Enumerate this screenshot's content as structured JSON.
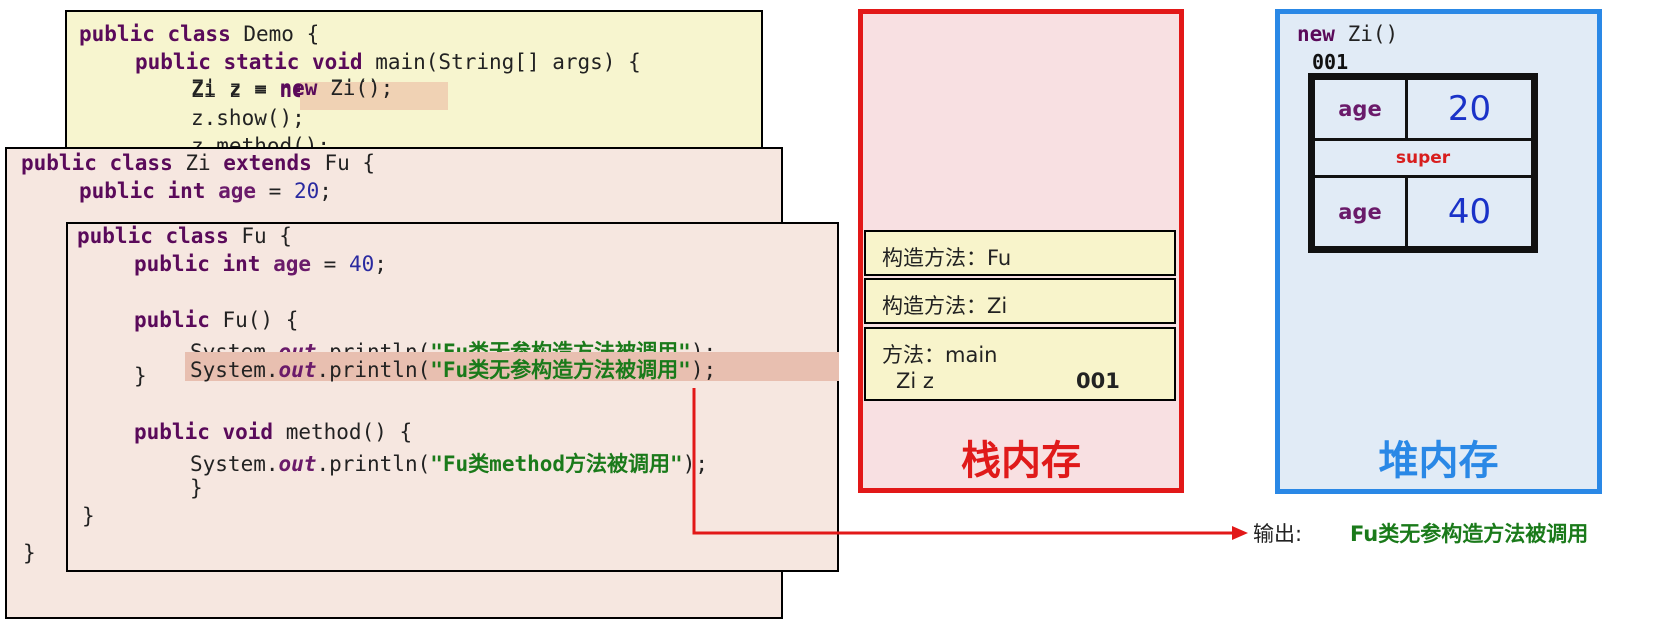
{
  "demo": {
    "l1_kw": "public class",
    "l1_txt": " Demo {",
    "l2_kw": "public static void",
    "l2_txt": " main(String[] args) {",
    "l3_pre": "Zi z = ",
    "l3_kw": "new",
    "l3_post": " Zi();",
    "l4": "z.show();",
    "l5": "z.method();"
  },
  "zi": {
    "l1_kw1": "public class",
    "l1_txt1": " Zi ",
    "l1_kw2": "extends",
    "l1_txt2": " Fu {",
    "l2_kw": "public int",
    "l2_id": "age",
    "l2_eq": " = ",
    "l2_num": "20",
    "l2_end": ";",
    "close": "}"
  },
  "fu": {
    "l1_kw": "public class",
    "l1_txt": " Fu {",
    "l2_kw": "public int",
    "l2_id": "age",
    "l2_eq": " = ",
    "l2_num": "40",
    "l2_end": ";",
    "ctor_kw": "public",
    "ctor_txt": " Fu() {",
    "p1_pre": "System.",
    "p1_out": "out",
    "p1_mid": ".println(",
    "p1_str": "\"Fu类无参构造方法被调用\"",
    "p1_end": ");",
    "close1": "}",
    "m_kw": "public void",
    "m_txt": " method() {",
    "p2_pre": "System.",
    "p2_out": "out",
    "p2_mid": ".println(",
    "p2_str": "\"Fu类method方法被调用\"",
    "p2_end": ");",
    "close2": "}",
    "close3": "}"
  },
  "stack": {
    "label": "栈内存",
    "frame_fu": "构造方法：Fu",
    "frame_zi": "构造方法：Zi",
    "frame_main": "方法：main",
    "var_name": "Zi z",
    "var_value": "001"
  },
  "heap": {
    "label": "堆内存",
    "title_kw": "new",
    "title_txt": " Zi()",
    "address": "001",
    "field1_name": "age",
    "field1_value": "20",
    "super_label": "super",
    "field2_name": "age",
    "field2_value": "40"
  },
  "output": {
    "label": "输出:",
    "text": "Fu类无参构造方法被调用"
  },
  "colors": {
    "stack_border": "#e21818",
    "heap_border": "#2a88e6",
    "arrow": "#e21818",
    "string": "#1a7a1a"
  }
}
